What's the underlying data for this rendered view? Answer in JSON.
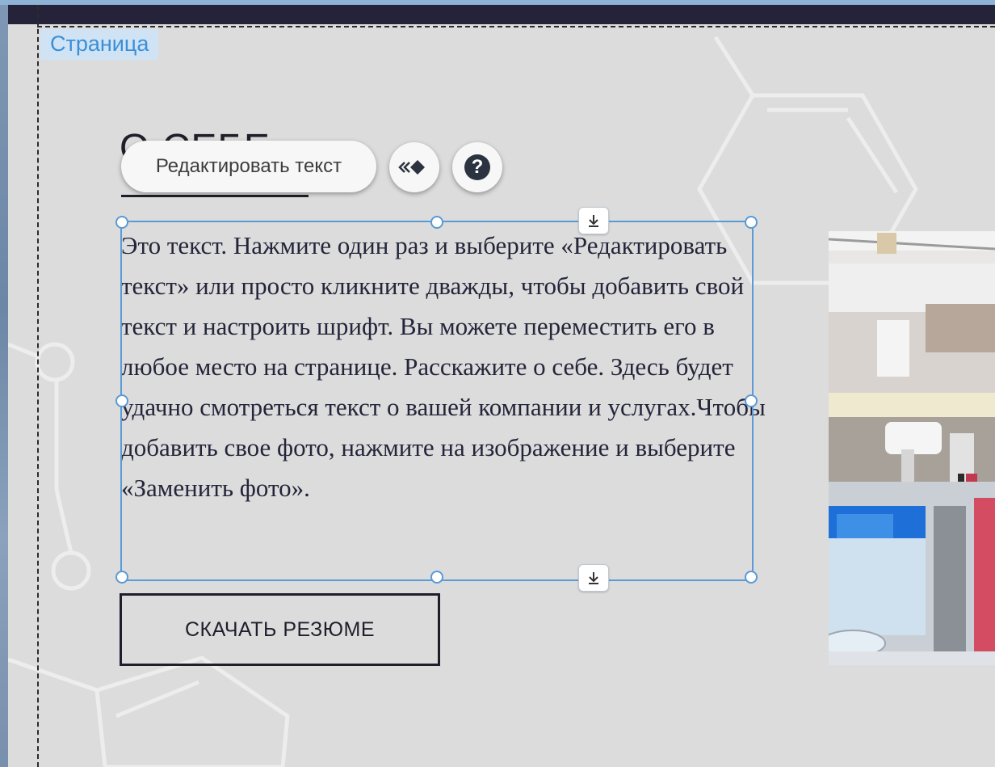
{
  "page_tag": "Страница",
  "section": {
    "title": "О СЕБЕ",
    "body": "Это текст. Нажмите один раз и выберите «Редактировать текст» или просто кликните дважды, чтобы добавить свой текст и настроить шрифт. Вы можете переместить его в любое место на странице. Расскажите о себе. Здесь будет удачно смотреться текст о вашей компании и услугах.Чтобы добавить свое фото, нажмите на изображение и выберите «Заменить фото».",
    "resume_button": "СКАЧАТЬ РЕЗЮМЕ"
  },
  "toolbar": {
    "edit_text_label": "Редактировать текст",
    "animation_icon": "animation-icon",
    "help_icon": "help-icon",
    "help_glyph": "?"
  },
  "colors": {
    "page_bg": "#dcdcdc",
    "topbar": "#24233a",
    "selection": "#5a9ad6",
    "text": "#24253a"
  }
}
